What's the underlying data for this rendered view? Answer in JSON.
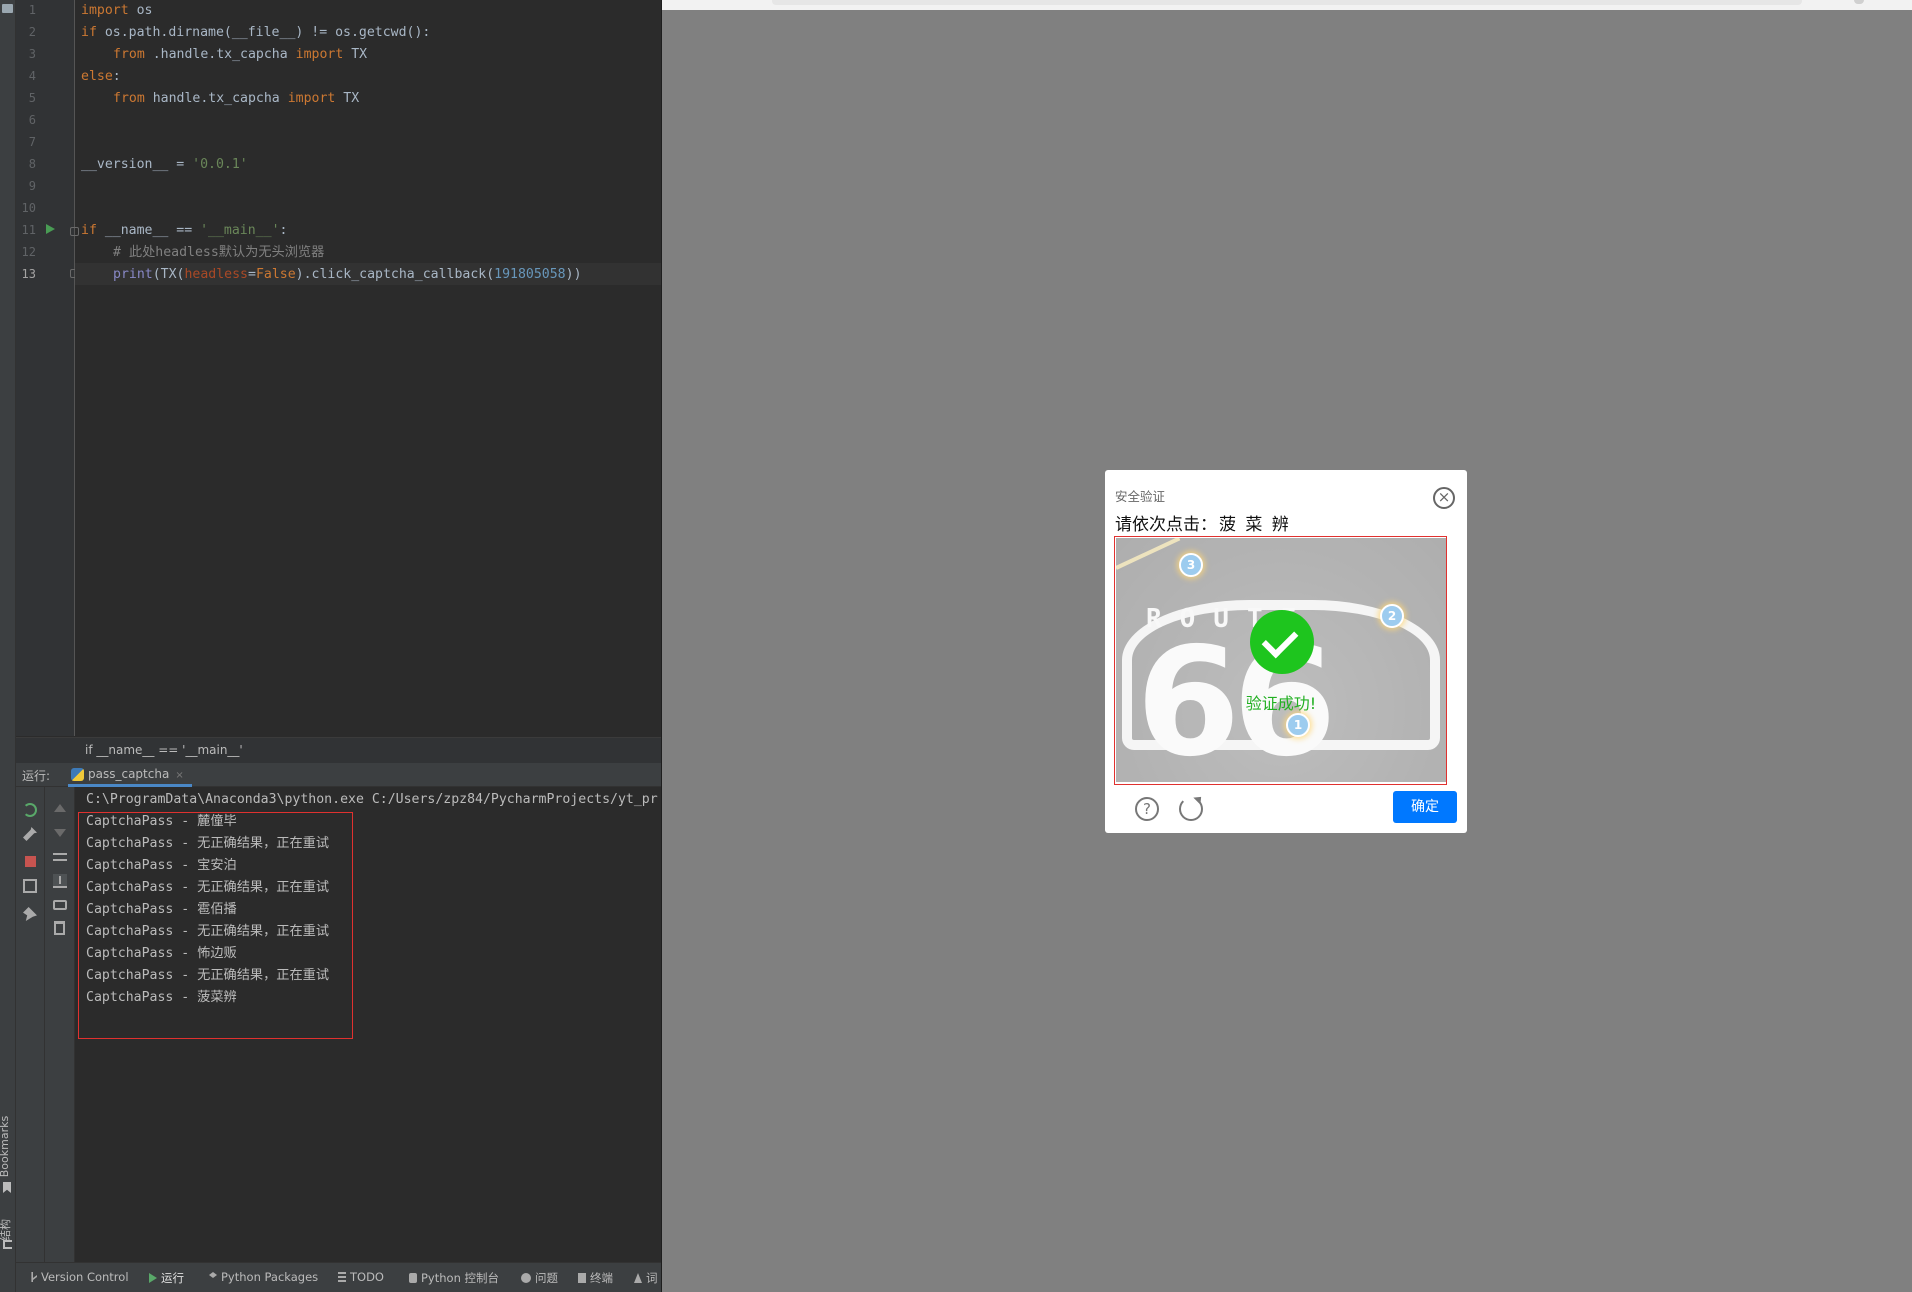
{
  "editor": {
    "line_numbers": [
      "1",
      "2",
      "3",
      "4",
      "5",
      "6",
      "7",
      "8",
      "9",
      "10",
      "11",
      "12",
      "13"
    ],
    "current_line": "13",
    "code": {
      "l1_kw": "import",
      "l1_rest": " os",
      "l2_kw": "if",
      "l2_rest": " os.path.dirname(__file__) != os.getcwd():",
      "l3_kw1": "from",
      "l3_mid": " .handle.tx_capcha ",
      "l3_kw2": "import",
      "l3_rest": " TX",
      "l4_kw": "else",
      "l4_rest": ":",
      "l5_kw1": "from",
      "l5_mid": " handle.tx_capcha ",
      "l5_kw2": "import",
      "l5_rest": " TX",
      "l8_a": "__version__ = ",
      "l8_str": "'0.0.1'",
      "l11_kw": "if",
      "l11_a": " __name__ == ",
      "l11_str": "'__main__'",
      "l11_b": ":",
      "l12_comment": "# 此处headless默认为无头浏览器",
      "l13_fn": "print",
      "l13_a": "(TX(",
      "l13_param": "headless",
      "l13_b": "=",
      "l13_kw": "False",
      "l13_c": ").click_captcha_callback(",
      "l13_num": "191805058",
      "l13_d": "))"
    },
    "breadcrumb": "if __name__ == '__main__'"
  },
  "run_panel": {
    "title": "运行:",
    "tab_label": "pass_captcha",
    "tab_close": "×",
    "command": "C:\\ProgramData\\Anaconda3\\python.exe C:/Users/zpz84/PycharmProjects/yt_pr",
    "output": [
      "CaptchaPass - 麓僮毕",
      "CaptchaPass - 无正确结果，正在重试",
      "CaptchaPass - 宝安泊",
      "CaptchaPass - 无正确结果，正在重试",
      "CaptchaPass - 雹佰播",
      "CaptchaPass - 无正确结果，正在重试",
      "CaptchaPass - 怖边贩",
      "CaptchaPass - 无正确结果，正在重试",
      "CaptchaPass - 菠菜辨"
    ]
  },
  "side_labels": {
    "bookmarks": "Bookmarks",
    "structure": "结构"
  },
  "status_bar": {
    "version_control": "Version Control",
    "run": "运行",
    "python_packages": "Python Packages",
    "todo": "TODO",
    "python_console": "Python 控制台",
    "problems": "问题",
    "terminal": "终端",
    "more": "词"
  },
  "captcha": {
    "header": "安全验证",
    "close_icon": "close-icon",
    "instruction_prefix": "请依次点击：",
    "instruction_chars": "菠 菜 辨",
    "success_text": "验证成功!",
    "marks": [
      "1",
      "2",
      "3"
    ],
    "confirm_label": "确定",
    "help_symbol": "?",
    "accent_color": "#0078ff",
    "success_color": "#1ec51e"
  },
  "colors": {
    "editor_bg": "#2b2b2b",
    "overlay_bg": "#808080",
    "highlight_border": "#e0312f"
  }
}
